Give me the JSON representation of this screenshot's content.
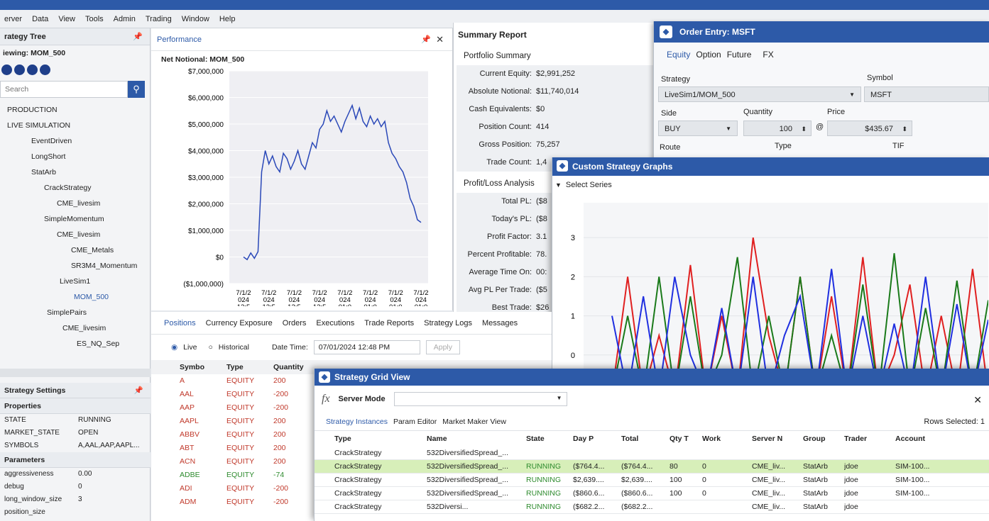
{
  "menu": [
    "erver",
    "Data",
    "View",
    "Tools",
    "Admin",
    "Trading",
    "Window",
    "Help"
  ],
  "tree": {
    "title": "rategy Tree",
    "viewing": "iewing: MOM_500",
    "search_placeholder": "Search",
    "items": [
      {
        "label": "PRODUCTION",
        "indent": 10,
        "sel": false
      },
      {
        "label": "LIVE SIMULATION",
        "indent": 10,
        "sel": false
      },
      {
        "label": "EventDriven",
        "indent": 44,
        "sel": false
      },
      {
        "label": "LongShort",
        "indent": 44,
        "sel": false
      },
      {
        "label": "StatArb",
        "indent": 44,
        "sel": false
      },
      {
        "label": "CrackStrategy",
        "indent": 62,
        "sel": false
      },
      {
        "label": "CME_livesim",
        "indent": 80,
        "sel": false
      },
      {
        "label": "SimpleMomentum",
        "indent": 62,
        "sel": false
      },
      {
        "label": "CME_livesim",
        "indent": 80,
        "sel": false
      },
      {
        "label": "CME_Metals",
        "indent": 100,
        "sel": false
      },
      {
        "label": "SR3M4_Momentum",
        "indent": 100,
        "sel": false
      },
      {
        "label": "LiveSim1",
        "indent": 84,
        "sel": false
      },
      {
        "label": "MOM_500",
        "indent": 104,
        "sel": true
      },
      {
        "label": "SimplePairs",
        "indent": 66,
        "sel": false
      },
      {
        "label": "CME_livesim",
        "indent": 88,
        "sel": false
      },
      {
        "label": "ES_NQ_Sep",
        "indent": 108,
        "sel": false
      }
    ]
  },
  "settings": {
    "title": "Strategy Settings",
    "properties_label": "Properties",
    "properties": [
      {
        "k": "STATE",
        "v": "RUNNING"
      },
      {
        "k": "MARKET_STATE",
        "v": "OPEN"
      },
      {
        "k": "SYMBOLS",
        "v": "A,AAL,AAP,AAPL..."
      }
    ],
    "parameters_label": "Parameters",
    "parameters": [
      {
        "k": "aggressiveness",
        "v": "0.00"
      },
      {
        "k": "debug",
        "v": "0"
      },
      {
        "k": "long_window_size",
        "v": "3"
      },
      {
        "k": "position_size",
        "v": ""
      }
    ]
  },
  "performance": {
    "title": "Performance",
    "chart_title": "Net Notional: MOM_500"
  },
  "chart_data": [
    {
      "type": "line",
      "title": "Net Notional: MOM_500",
      "ylim": [
        -1000000,
        7000000
      ],
      "yticks": [
        "$7,000,000",
        "$6,000,000",
        "$5,000,000",
        "$4,000,000",
        "$3,000,000",
        "$2,000,000",
        "$1,000,000",
        "$0",
        "($1,000,000)"
      ],
      "xticks": [
        "7/1/2\n024\n12:5",
        "7/1/2\n024\n12:5",
        "7/1/2\n024\n12:5",
        "7/1/2\n024\n12:5",
        "7/1/2\n024\n01:0",
        "7/1/2\n024\n01:0",
        "7/1/2\n024\n01:0",
        "7/1/2\n024\n01:0"
      ],
      "values": [
        0,
        -100000,
        150000,
        -50000,
        200000,
        3200000,
        4000000,
        3500000,
        3800000,
        3400000,
        3200000,
        3900000,
        3700000,
        3300000,
        3600000,
        4000000,
        3500000,
        3300000,
        3800000,
        4300000,
        4100000,
        4800000,
        5000000,
        5500000,
        5100000,
        5300000,
        5000000,
        4700000,
        5100000,
        5400000,
        5700000,
        5200000,
        5600000,
        5100000,
        4900000,
        5300000,
        5000000,
        5200000,
        4900000,
        5100000,
        4300000,
        3900000,
        3700000,
        3400000,
        3200000,
        2800000,
        2200000,
        1900000,
        1400000,
        1300000
      ]
    },
    {
      "type": "line",
      "title": "Custom Strategy Graphs",
      "ylim": [
        -1,
        3.5
      ],
      "yticks": [
        "3",
        "2",
        "1",
        "0",
        "-1"
      ],
      "series": [
        {
          "name": "",
          "color": "#e02020",
          "values": [
            -1,
            2,
            -1,
            0.5,
            -1,
            2.3,
            -1,
            1,
            -1,
            3,
            0.5,
            -1,
            2,
            -1,
            1.5,
            -1,
            2.5,
            -1,
            0,
            1.8,
            -1,
            1,
            -1,
            2.2,
            -1
          ]
        },
        {
          "name": "",
          "color": "#1a7a1a",
          "values": [
            -1,
            1,
            -1,
            2,
            -1,
            1.5,
            -1,
            0,
            2.5,
            -1,
            1,
            -1,
            2,
            -1,
            0.5,
            -1,
            1.8,
            -1,
            2.6,
            -1,
            1.2,
            -1,
            1.9,
            -1,
            1.4
          ]
        },
        {
          "name": "",
          "color": "#1f2fe0",
          "values": [
            1,
            -1,
            1.5,
            -1,
            2,
            0,
            -1,
            1.2,
            -1,
            2,
            -1,
            0.5,
            1.5,
            -1,
            2.2,
            -1,
            1,
            -1,
            0.8,
            -1,
            2,
            -1,
            1.3,
            -1,
            0.9
          ]
        }
      ]
    }
  ],
  "summary": {
    "title": "Summary Report",
    "portfolio_label": "Portfolio Summary",
    "portfolio": [
      {
        "k": "Current Equity:",
        "v": "$2,991,252"
      },
      {
        "k": "Absolute Notional:",
        "v": "$11,740,014"
      },
      {
        "k": "Cash Equivalents:",
        "v": "$0"
      },
      {
        "k": "Position Count:",
        "v": "414"
      },
      {
        "k": "Gross Position:",
        "v": "75,257"
      },
      {
        "k": "Trade Count:",
        "v": "1,4"
      }
    ],
    "pl_label": "Profit/Loss Analysis",
    "pl": [
      {
        "k": "Total PL:",
        "v": "($8"
      },
      {
        "k": "Today's PL:",
        "v": "($8"
      },
      {
        "k": "Profit Factor:",
        "v": "3.1"
      },
      {
        "k": "Percent Profitable:",
        "v": "78."
      },
      {
        "k": "Average Time On:",
        "v": "00:"
      },
      {
        "k": "Avg PL Per Trade:",
        "v": "($5"
      },
      {
        "k": "Best Trade:",
        "v": "$26"
      }
    ]
  },
  "order": {
    "title": "Order Entry: MSFT",
    "tabs": [
      "Equity",
      "Option",
      "Future",
      "FX"
    ],
    "strategy_label": "Strategy",
    "strategy_value": "LiveSim1/MOM_500",
    "symbol_label": "Symbol",
    "symbol_value": "MSFT",
    "side_label": "Side",
    "side_value": "BUY",
    "qty_label": "Quantity",
    "qty_value": "100",
    "at": "@",
    "price_label": "Price",
    "price_value": "$435.67",
    "route_label": "Route",
    "type_label": "Type",
    "tif_label": "TIF"
  },
  "graphs": {
    "title": "Custom Strategy Graphs",
    "select_series": "Select Series"
  },
  "positions": {
    "tabs": [
      "Positions",
      "Currency Exposure",
      "Orders",
      "Executions",
      "Trade Reports",
      "Strategy Logs",
      "Messages"
    ],
    "live": "Live",
    "historical": "Historical",
    "datetime_label": "Date Time:",
    "datetime_value": "07/01/2024 12:48 PM",
    "apply": "Apply",
    "columns": [
      "Symbo",
      "Type",
      "Quantity"
    ],
    "rows": [
      {
        "s": "A",
        "t": "EQUITY",
        "q": "200"
      },
      {
        "s": "AAL",
        "t": "EQUITY",
        "q": "-200"
      },
      {
        "s": "AAP",
        "t": "EQUITY",
        "q": "-200"
      },
      {
        "s": "AAPL",
        "t": "EQUITY",
        "q": "200"
      },
      {
        "s": "ABBV",
        "t": "EQUITY",
        "q": "200"
      },
      {
        "s": "ABT",
        "t": "EQUITY",
        "q": "200"
      },
      {
        "s": "ACN",
        "t": "EQUITY",
        "q": "200"
      },
      {
        "s": "ADBE",
        "t": "EQUITY",
        "q": "-74"
      },
      {
        "s": "ADI",
        "t": "EQUITY",
        "q": "-200"
      },
      {
        "s": "ADM",
        "t": "EQUITY",
        "q": "-200"
      }
    ]
  },
  "grid": {
    "title": "Strategy Grid View",
    "server_mode": "Server Mode",
    "tabs": [
      "Strategy Instances",
      "Param Editor",
      "Market Maker View"
    ],
    "rows_selected": "Rows Selected: 1",
    "columns": [
      "Type",
      "Name",
      "State",
      "Day P",
      "Total",
      "Qty T",
      "Work",
      "Server N",
      "Group",
      "Trader",
      "Account"
    ],
    "rows": [
      {
        "type": "CrackStrategy",
        "name": "532DiversifiedSpread_...",
        "state": "",
        "day": "",
        "total": "",
        "qty": "",
        "work": "",
        "server": "",
        "group": "",
        "trader": "",
        "account": ""
      },
      {
        "type": "CrackStrategy",
        "name": "532DiversifiedSpread_...",
        "state": "RUNNING",
        "day": "($764.4...",
        "total": "($764.4...",
        "qty": "80",
        "work": "0",
        "server": "CME_liv...",
        "group": "StatArb",
        "trader": "jdoe",
        "account": "SIM-100..."
      },
      {
        "type": "CrackStrategy",
        "name": "532DiversifiedSpread_...",
        "state": "RUNNING",
        "day": "$2,639....",
        "total": "$2,639....",
        "qty": "100",
        "work": "0",
        "server": "CME_liv...",
        "group": "StatArb",
        "trader": "jdoe",
        "account": "SIM-100..."
      },
      {
        "type": "CrackStrategy",
        "name": "532DiversifiedSpread_...",
        "state": "RUNNING",
        "day": "($860.6...",
        "total": "($860.6...",
        "qty": "100",
        "work": "0",
        "server": "CME_liv...",
        "group": "StatArb",
        "trader": "jdoe",
        "account": "SIM-100..."
      },
      {
        "type": "CrackStrategy",
        "name": "532Diversi...",
        "state": "RUNNING",
        "day": "($682.2...",
        "total": "($682.2...",
        "qty": "",
        "work": "",
        "server": "CME_liv...",
        "group": "StatArb",
        "trader": "jdoe",
        "account": ""
      }
    ]
  }
}
